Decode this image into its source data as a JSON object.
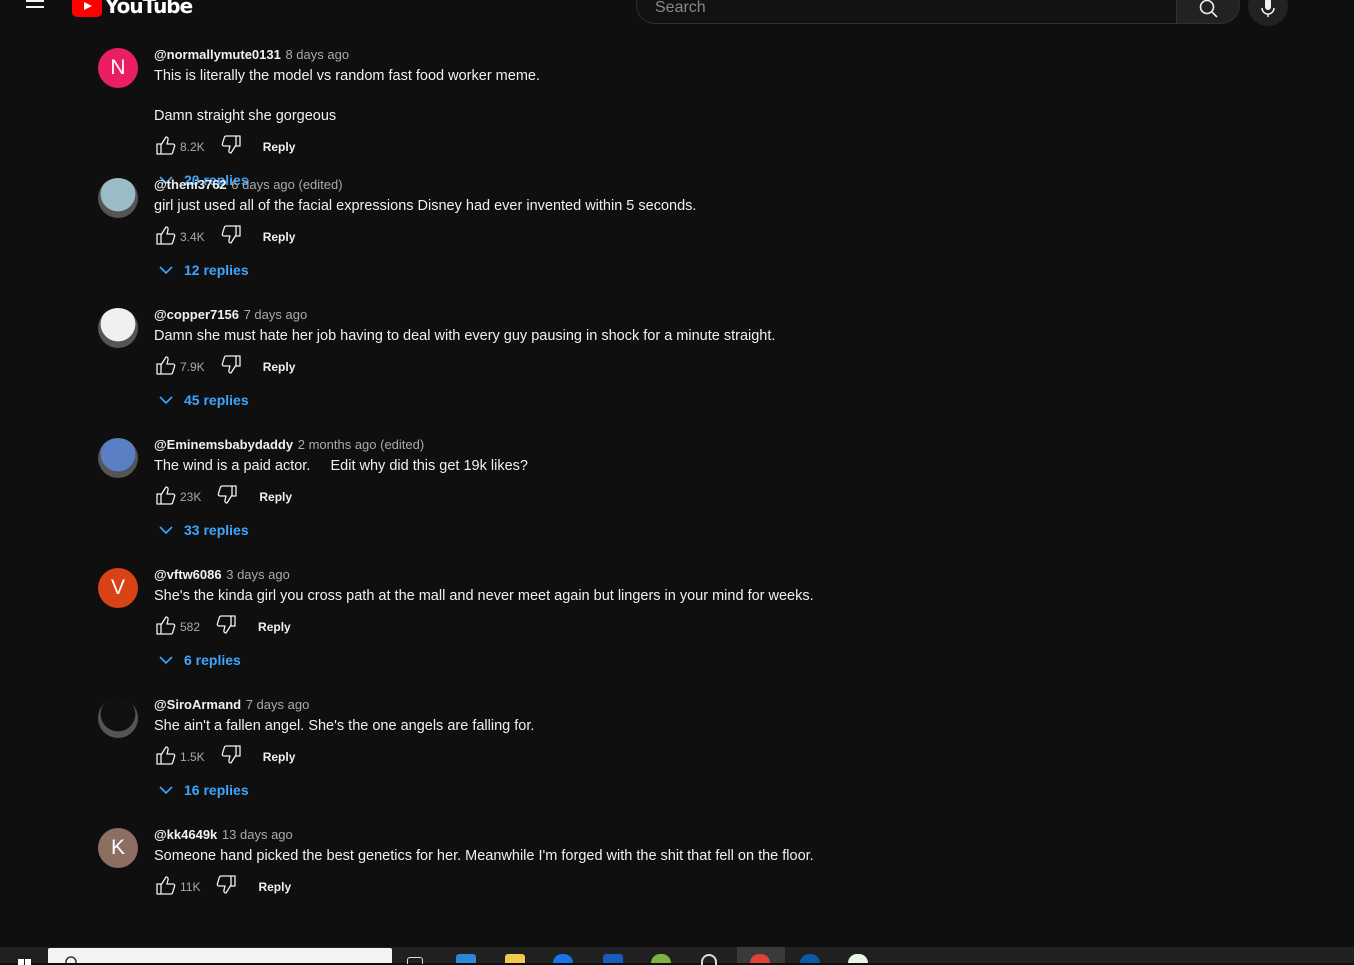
{
  "header": {
    "logo_text": "YouTube",
    "search_placeholder": "Search"
  },
  "colors": {
    "background": "#0f0f0f",
    "link_blue": "#3ea6ff",
    "meta_gray": "#aaaaaa"
  },
  "comments": [
    {
      "author": "@normallymute0131",
      "time": "8 days ago",
      "text": "This is literally the model vs random fast food worker meme.\n\nDamn straight she gorgeous",
      "likes": "8.2K",
      "reply_label": "Reply",
      "replies_label": "20 replies",
      "avatar": {
        "type": "letter",
        "letter": "N",
        "color": "#e91e63"
      }
    },
    {
      "author": "@theni3762",
      "time": "6 days ago (edited)",
      "text": "girl just used all of the facial expressions Disney had ever invented within 5 seconds.",
      "likes": "3.4K",
      "reply_label": "Reply",
      "replies_label": "12 replies",
      "avatar": {
        "type": "image",
        "color": "#9bbcc7"
      }
    },
    {
      "author": "@copper7156",
      "time": "7 days ago",
      "text": "Damn she must hate her job having to deal with every guy pausing in shock for a minute straight.",
      "likes": "7.9K",
      "reply_label": "Reply",
      "replies_label": "45 replies",
      "avatar": {
        "type": "image",
        "color": "#f0f0f0"
      }
    },
    {
      "author": "@Eminemsbabydaddy",
      "time": "2 months ago (edited)",
      "text": "The wind is a paid actor.     Edit why did this get 19k likes?",
      "likes": "23K",
      "reply_label": "Reply",
      "replies_label": "33 replies",
      "avatar": {
        "type": "image",
        "color": "#5b7fc4"
      }
    },
    {
      "author": "@vftw6086",
      "time": "3 days ago",
      "text": "She's the kinda girl you cross path at the mall and never meet again but lingers in your mind for weeks.",
      "likes": "582",
      "reply_label": "Reply",
      "replies_label": "6 replies",
      "avatar": {
        "type": "letter",
        "letter": "V",
        "color": "#d84315"
      }
    },
    {
      "author": "@SiroArmand",
      "time": "7 days ago",
      "text": "She ain't a fallen angel. She's the one angels are falling for.",
      "likes": "1.5K",
      "reply_label": "Reply",
      "replies_label": "16 replies",
      "avatar": {
        "type": "image",
        "color": "#111111"
      }
    },
    {
      "author": "@kk4649k",
      "time": "13 days ago",
      "text": "Someone hand picked the best genetics for her. Meanwhile I'm forged with the shit that fell on the floor.",
      "likes": "11K",
      "reply_label": "Reply",
      "replies_label": "",
      "avatar": {
        "type": "letter",
        "letter": "K",
        "color": "#8d6e63"
      }
    }
  ]
}
